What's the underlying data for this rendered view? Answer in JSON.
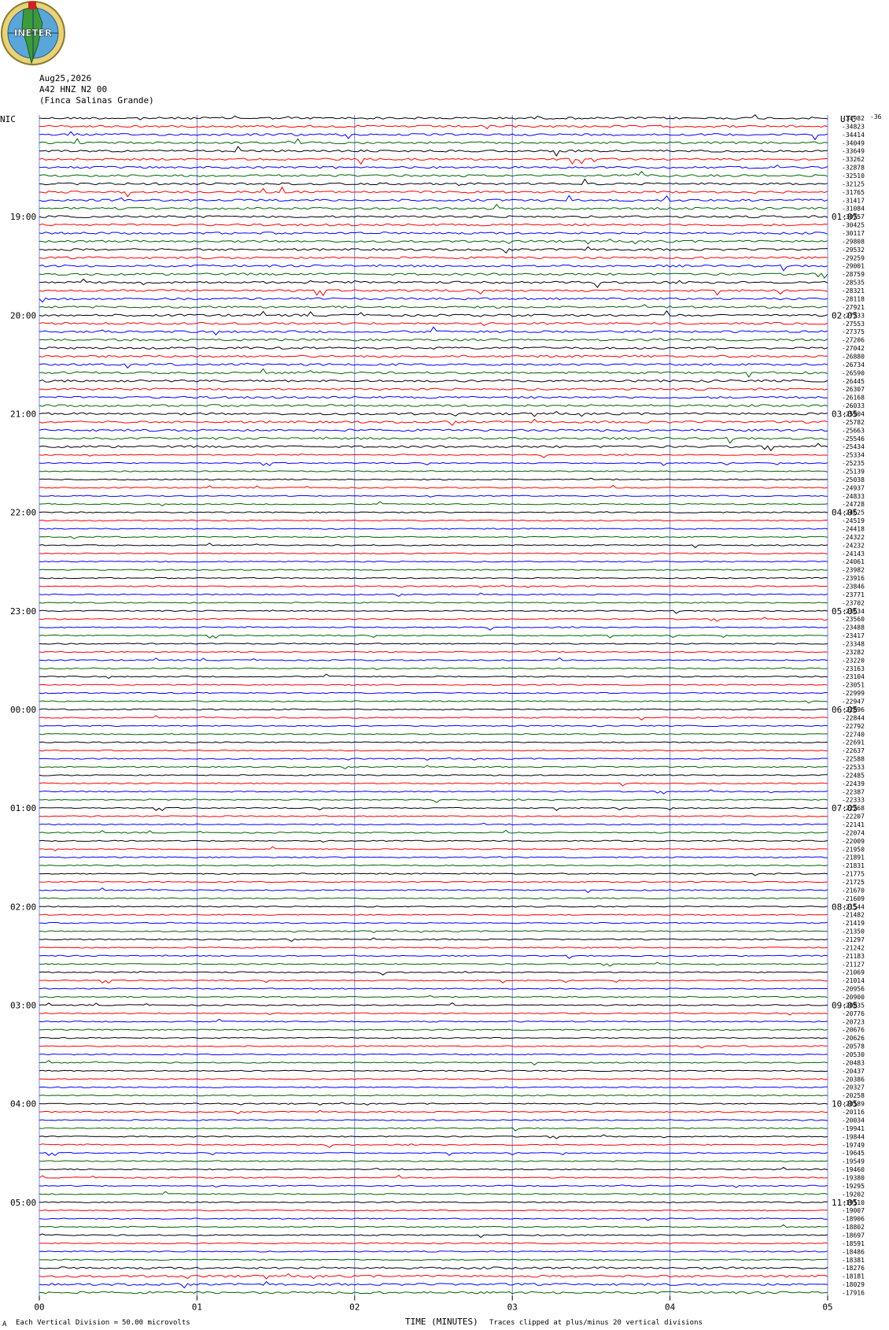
{
  "header": {
    "date": "Aug25,2026",
    "station": "A42 HNZ N2 00",
    "site": "(Finca Salinas Grande)",
    "left_zone": "NIC",
    "right_zone": "UTC",
    "right_top_marker": "-36"
  },
  "logo": {
    "text": "INETER"
  },
  "colors": {
    "black": "#000000",
    "red": "#ff0000",
    "blue": "#0000ff",
    "green": "#006400",
    "grid": "#5566cc"
  },
  "chart_data": {
    "type": "line",
    "title": "",
    "xlabel": "TIME (MINUTES)",
    "xticks": [
      "00",
      "01",
      "02",
      "03",
      "04",
      "05"
    ],
    "xlim": [
      0,
      5
    ],
    "trace_color_cycle": [
      "black",
      "red",
      "blue",
      "green"
    ],
    "left_hour_labels": [
      "19:00",
      "20:00",
      "21:00",
      "22:00",
      "23:00",
      "00:00",
      "01:00",
      "02:00",
      "03:00",
      "04:00",
      "05:00"
    ],
    "right_hour_labels": [
      "01:05",
      "02:05",
      "03:05",
      "04:05",
      "05:05",
      "06:05",
      "07:05",
      "08:05",
      "09:05",
      "10:05",
      "11:05"
    ],
    "trace_values": [
      "-34982",
      "-34823",
      "-34414",
      "-34049",
      "-33649",
      "-33262",
      "-32878",
      "-32510",
      "-32125",
      "-31765",
      "-31417",
      "-31084",
      "-30757",
      "-30425",
      "-30117",
      "-29808",
      "-29532",
      "-29259",
      "-29001",
      "-28759",
      "-28535",
      "-28321",
      "-28118",
      "-27921",
      "-27733",
      "-27553",
      "-27375",
      "-27206",
      "-27042",
      "-26880",
      "-26734",
      "-26590",
      "-26445",
      "-26307",
      "-26168",
      "-26033",
      "-25904",
      "-25782",
      "-25663",
      "-25546",
      "-25434",
      "-25334",
      "-25235",
      "-25139",
      "-25038",
      "-24937",
      "-24833",
      "-24728",
      "-24625",
      "-24519",
      "-24418",
      "-24322",
      "-24232",
      "-24143",
      "-24061",
      "-23982",
      "-23916",
      "-23846",
      "-23771",
      "-23702",
      "-23634",
      "-23560",
      "-23488",
      "-23417",
      "-23348",
      "-23282",
      "-23220",
      "-23163",
      "-23104",
      "-23051",
      "-22999",
      "-22947",
      "-22896",
      "-22844",
      "-22792",
      "-22740",
      "-22691",
      "-22637",
      "-22588",
      "-22533",
      "-22485",
      "-22439",
      "-22387",
      "-22333",
      "-22268",
      "-22207",
      "-22141",
      "-22074",
      "-22009",
      "-21950",
      "-21891",
      "-21831",
      "-21775",
      "-21725",
      "-21670",
      "-21609",
      "-21544",
      "-21482",
      "-21419",
      "-21350",
      "-21297",
      "-21242",
      "-21183",
      "-21127",
      "-21069",
      "-21014",
      "-20956",
      "-20900",
      "-20835",
      "-20776",
      "-20723",
      "-20676",
      "-20626",
      "-20578",
      "-20530",
      "-20483",
      "-20437",
      "-20386",
      "-20327",
      "-20258",
      "-20189",
      "-20116",
      "-20034",
      "-19941",
      "-19844",
      "-19749",
      "-19645",
      "-19549",
      "-19460",
      "-19380",
      "-19295",
      "-19202",
      "-19110",
      "-19007",
      "-18906",
      "-18802",
      "-18697",
      "-18591",
      "-18486",
      "-18381",
      "-18276",
      "-18181",
      "-18029",
      "-17916"
    ]
  },
  "footer": {
    "division_label": "Each Vertical Division =",
    "division_value": "50.00 microvolts",
    "clip_note": "Traces clipped at plus/minus 20 vertical divisions",
    "corner_mark": "A"
  }
}
